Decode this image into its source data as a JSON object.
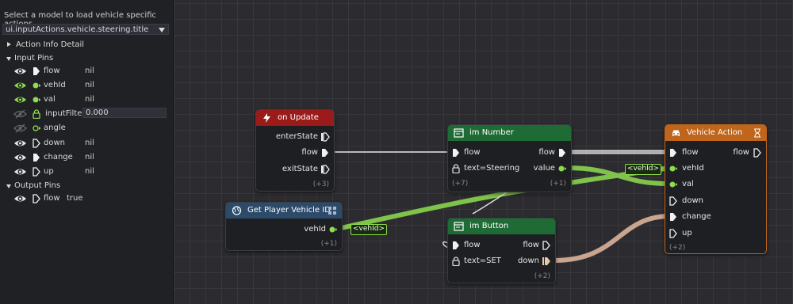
{
  "sidebar": {
    "hint": "Select a model to load vehicle specific actions.",
    "selector_value": "ui.inputActions.vehicle.steering.title",
    "action_info_label": "Action Info Detail",
    "input_pins_label": "Input Pins",
    "input_pins": [
      {
        "name": "flow",
        "value": "nil",
        "type": "flow",
        "visible": true
      },
      {
        "name": "vehId",
        "value": "nil",
        "type": "data",
        "visible": true
      },
      {
        "name": "val",
        "value": "nil",
        "type": "data",
        "visible": true
      },
      {
        "name": "inputFilter",
        "value": "0.000",
        "type": "lock",
        "visible": false
      },
      {
        "name": "angle",
        "value": "",
        "type": "data-hollow",
        "visible": false
      },
      {
        "name": "down",
        "value": "nil",
        "type": "flow-hollow",
        "visible": true
      },
      {
        "name": "change",
        "value": "nil",
        "type": "flow",
        "visible": true
      },
      {
        "name": "up",
        "value": "nil",
        "type": "flow-hollow",
        "visible": true
      }
    ],
    "output_pins_label": "Output Pins",
    "output_pins": [
      {
        "name": "flow",
        "value": "true",
        "type": "flow-hollow",
        "visible": true
      }
    ]
  },
  "colors": {
    "red_header": "#9b1b1b",
    "blue_header": "#2c4a6a",
    "green_header": "#1e6b35",
    "orange_header": "#c0651c",
    "wire_green": "#7fc34a",
    "wire_tan": "#c9a48e",
    "pin_green": "#8fdc4e"
  },
  "nodes": {
    "on_update": {
      "title": "on Update",
      "icon": "lightning-icon",
      "pins": [
        "enterState",
        "flow",
        "exitState"
      ],
      "count": "(+3)"
    },
    "get_vehicle": {
      "title": "Get Player Vehicle ID",
      "icon": "globe-icon",
      "pins": [
        "vehId"
      ],
      "count": "(+1)",
      "badge": "<vehId>"
    },
    "im_number": {
      "title": "im Number",
      "icon": "window-icon",
      "in_flow": "flow",
      "out_flow": "flow",
      "lock_label": "text=Steering",
      "out_value": "value",
      "count_left": "(+7)",
      "count_right": "(+1)"
    },
    "im_button": {
      "title": "im Button",
      "icon": "window-icon",
      "in_flow": "flow",
      "out_flow": "flow",
      "lock_label": "text=SET",
      "out_down": "down",
      "count": "(+2)"
    },
    "vehicle_action": {
      "title": "Vehicle Action",
      "icon": "car-icon",
      "in_pins": [
        "flow",
        "vehId",
        "val",
        "down",
        "change",
        "up"
      ],
      "out_flow": "flow",
      "count": "(+2)",
      "badge": "<vehId>"
    }
  }
}
